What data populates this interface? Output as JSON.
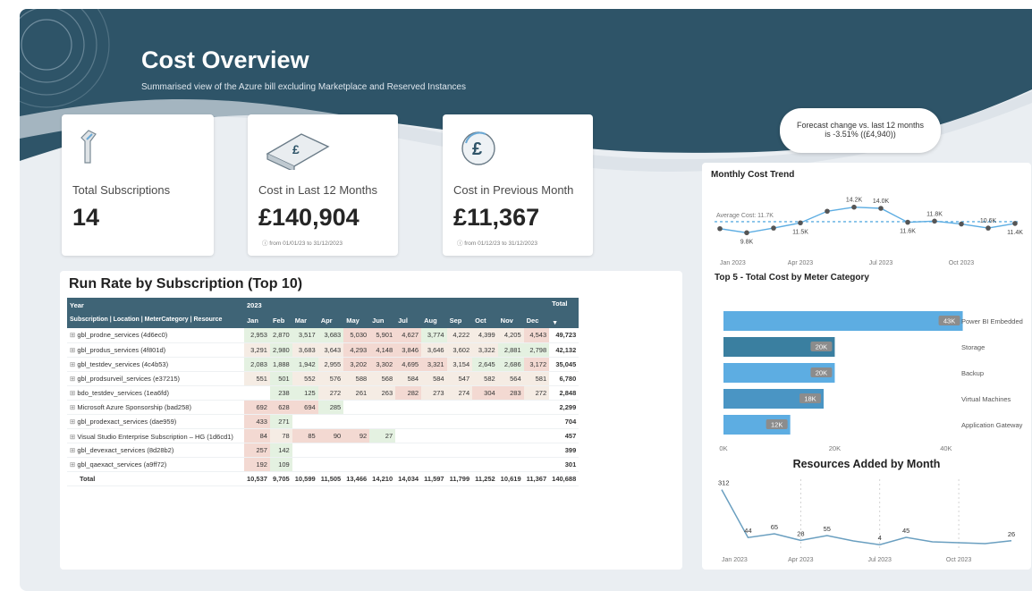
{
  "header": {
    "title": "Cost Overview",
    "subtitle": "Summarised view of the Azure bill excluding Marketplace and Reserved Instances"
  },
  "kpis": [
    {
      "label": "Total Subscriptions",
      "value": "14",
      "note": "",
      "icon": "azure-key-icon"
    },
    {
      "label": "Cost in Last 12 Months",
      "value": "£140,904",
      "note": "ⓘ  from 01/01/23 to 31/12/2023",
      "icon": "cash-stack-icon"
    },
    {
      "label": "Cost in Previous Month",
      "value": "£11,367",
      "note": "ⓘ  from 01/12/23 to 31/12/2023",
      "icon": "pound-coin-icon"
    }
  ],
  "forecast": {
    "line1": "Forecast change vs. last 12 months",
    "line2": "is -3.51% ((£4,940))"
  },
  "run_rate": {
    "title": "Run Rate by Subscription (Top 10)",
    "year_header": "Year",
    "year": "2023",
    "total_header": "Total",
    "row_header": "Subscription | Location | MeterCategory | Resource",
    "months": [
      "Jan",
      "Feb",
      "Mar",
      "Apr",
      "May",
      "Jun",
      "Jul",
      "Aug",
      "Sep",
      "Oct",
      "Nov",
      "Dec"
    ],
    "rows": [
      {
        "name": "gbl_prodne_services (4d6ec0)",
        "values": [
          "2,953",
          "2,870",
          "3,517",
          "3,683",
          "5,030",
          "5,901",
          "4,627",
          "3,774",
          "4,222",
          "4,399",
          "4,205",
          "4,543"
        ],
        "total": "49,723"
      },
      {
        "name": "gbl_produs_services (4f801d)",
        "values": [
          "3,291",
          "2,980",
          "3,683",
          "3,643",
          "4,293",
          "4,148",
          "3,846",
          "3,646",
          "3,602",
          "3,322",
          "2,881",
          "2,798"
        ],
        "total": "42,132"
      },
      {
        "name": "gbl_testdev_services (4c4b53)",
        "values": [
          "2,083",
          "1,888",
          "1,942",
          "2,955",
          "3,202",
          "3,302",
          "4,695",
          "3,321",
          "3,154",
          "2,645",
          "2,686",
          "3,172"
        ],
        "total": "35,045"
      },
      {
        "name": "gbl_prodsurveil_services (e37215)",
        "values": [
          "551",
          "501",
          "552",
          "576",
          "588",
          "568",
          "584",
          "584",
          "547",
          "582",
          "564",
          "581"
        ],
        "total": "6,780"
      },
      {
        "name": "bdo_testdev_services (1ea6fd)",
        "values": [
          "",
          "238",
          "125",
          "272",
          "261",
          "263",
          "282",
          "273",
          "274",
          "304",
          "283",
          "272"
        ],
        "total": "2,848"
      },
      {
        "name": "Microsoft Azure Sponsorship (bad258)",
        "values": [
          "692",
          "628",
          "694",
          "285",
          "",
          "",
          "",
          "",
          "",
          "",
          "",
          ""
        ],
        "total": "2,299"
      },
      {
        "name": "gbl_prodexact_services (dae959)",
        "values": [
          "433",
          "271",
          "",
          "",
          "",
          "",
          "",
          "",
          "",
          "",
          "",
          ""
        ],
        "total": "704"
      },
      {
        "name": "Visual Studio Enterprise Subscription – HG (1d6cd1)",
        "values": [
          "84",
          "78",
          "85",
          "90",
          "92",
          "27",
          "",
          "",
          "",
          "",
          "",
          ""
        ],
        "total": "457"
      },
      {
        "name": "gbl_devexact_services (8d28b2)",
        "values": [
          "257",
          "142",
          "",
          "",
          "",
          "",
          "",
          "",
          "",
          "",
          "",
          ""
        ],
        "total": "399"
      },
      {
        "name": "gbl_qaexact_services (a9ff72)",
        "values": [
          "192",
          "109",
          "",
          "",
          "",
          "",
          "",
          "",
          "",
          "",
          "",
          ""
        ],
        "total": "301"
      }
    ],
    "totals_label": "Total",
    "totals": [
      "10,537",
      "9,705",
      "10,599",
      "11,505",
      "13,466",
      "14,210",
      "14,034",
      "11,597",
      "11,799",
      "11,252",
      "10,619",
      "11,367"
    ],
    "grand_total": "140,688",
    "colors": {
      "header": "#3f6476",
      "high": "#f3d9d2",
      "mid": "#f5ece4",
      "low": "#e4f1e1"
    }
  },
  "monthly_trend": {
    "title": "Monthly Cost Trend",
    "average_label": "Average Cost: 11.7K",
    "x_ticks": [
      "Jan 2023",
      "Apr 2023",
      "Jul 2023",
      "Oct 2023"
    ]
  },
  "meter_categories": {
    "title": "Top 5 - Total Cost by Meter Category",
    "x_ticks": [
      "0K",
      "20K",
      "40K"
    ]
  },
  "resources_added": {
    "title": "Resources Added by Month",
    "x_ticks": [
      "Jan 2023",
      "Apr 2023",
      "Jul 2023",
      "Oct 2023"
    ]
  },
  "chart_data": [
    {
      "type": "line",
      "title": "Monthly Cost Trend",
      "x": [
        "Jan 2023",
        "Feb 2023",
        "Mar 2023",
        "Apr 2023",
        "May 2023",
        "Jun 2023",
        "Jul 2023",
        "Aug 2023",
        "Sep 2023",
        "Oct 2023",
        "Nov 2023",
        "Dec 2023"
      ],
      "values": [
        10.5,
        9.8,
        10.6,
        11.5,
        13.5,
        14.2,
        14.0,
        11.6,
        11.8,
        11.3,
        10.6,
        11.4
      ],
      "labels": [
        "",
        "9.8K",
        "",
        "11.5K",
        "",
        "14.2K",
        "14.0K",
        "11.6K",
        "11.8K",
        "",
        "10.6K",
        "11.4K"
      ],
      "average": 11.7,
      "ylim": [
        8,
        16
      ],
      "colors": {
        "line": "#5dade2",
        "point": "#555555",
        "average": "#5dade2"
      }
    },
    {
      "type": "bar",
      "title": "Top 5 - Total Cost by Meter Category",
      "categories": [
        "Power BI Embedded",
        "Storage",
        "Backup",
        "Virtual Machines",
        "Application Gateway"
      ],
      "values": [
        43,
        20,
        20,
        18,
        12
      ],
      "labels": [
        "43K",
        "20K",
        "20K",
        "18K",
        "12K"
      ],
      "xlim": [
        0,
        45
      ],
      "colors": [
        "#5dade2",
        "#3a7fa0",
        "#5dade2",
        "#4a95c4",
        "#5dade2"
      ]
    },
    {
      "type": "line",
      "title": "Resources Added by Month",
      "x": [
        "Jan 2023",
        "Feb 2023",
        "Mar 2023",
        "Apr 2023",
        "May 2023",
        "Jun 2023",
        "Jul 2023",
        "Aug 2023",
        "Sep 2023",
        "Oct 2023",
        "Nov 2023",
        "Dec 2023"
      ],
      "values": [
        312,
        44,
        65,
        28,
        55,
        25,
        4,
        45,
        20,
        15,
        10,
        26
      ],
      "labels": [
        "312",
        "44",
        "65",
        "28",
        "55",
        "",
        "4",
        "45",
        "",
        "",
        "",
        "26"
      ],
      "ylim": [
        0,
        330
      ],
      "colors": {
        "line": "#6a9fc0"
      }
    }
  ]
}
